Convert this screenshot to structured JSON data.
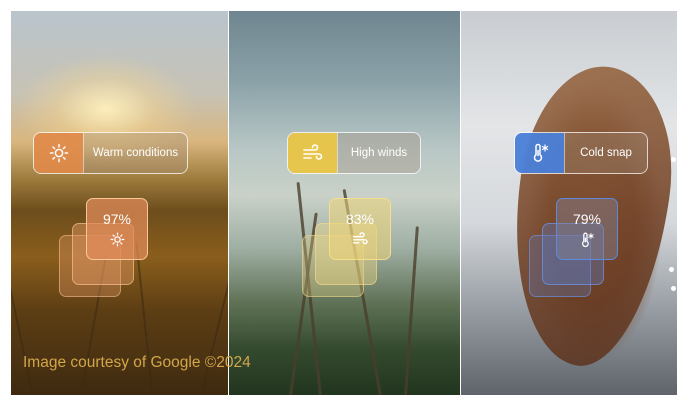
{
  "panels": [
    {
      "condition_label": "Warm conditions",
      "percent": "97%",
      "icon": "sun-icon",
      "accent": "#E08A4A"
    },
    {
      "condition_label": "High winds",
      "percent": "83%",
      "icon": "wind-icon",
      "accent": "#E9C547"
    },
    {
      "condition_label": "Cold snap",
      "percent": "79%",
      "icon": "thermometer-snow-icon",
      "accent": "#4A7FD8"
    }
  ],
  "credit": "Image courtesy of Google ©2024"
}
